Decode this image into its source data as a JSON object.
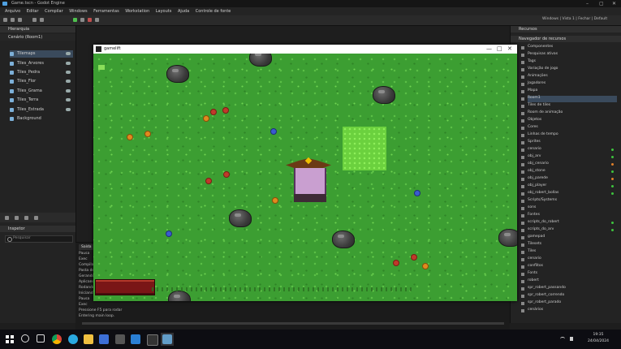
{
  "editor": {
    "title": "Game.tscn - Godot Engine",
    "menus": [
      "Arquivo",
      "Editar",
      "Compilar",
      "Windows",
      "Ferramentas",
      "Workstation",
      "Layouts",
      "Ajuda",
      "Controle de fonte"
    ],
    "right_info": "Windows | Vista 1 | Fechar | Default"
  },
  "hierarchy": {
    "header": "Hierarquia",
    "filter_label": "Cenário (Room1)",
    "items": [
      {
        "label": "Tilemaps"
      },
      {
        "label": "Tiles_Arvores"
      },
      {
        "label": "Tiles_Pedra"
      },
      {
        "label": "Tiles_Flor"
      },
      {
        "label": "Tiles_Grama"
      },
      {
        "label": "Tiles_Terra"
      },
      {
        "label": "Tiles_Estrada"
      },
      {
        "label": "Background"
      }
    ],
    "inspector_header": "Inspetor",
    "search_placeholder": "Pesquisar"
  },
  "right_panel": {
    "header": "Navegador de recursos",
    "search_label": "Recursos",
    "items": [
      {
        "label": "Componentes",
        "dot": ""
      },
      {
        "label": "Pesquisas ativas",
        "dot": ""
      },
      {
        "label": "Tags",
        "dot": ""
      },
      {
        "label": "Variação de jogo",
        "dot": ""
      },
      {
        "label": "Animações",
        "dot": ""
      },
      {
        "label": "Jogadores",
        "dot": ""
      },
      {
        "label": "Mapa",
        "dot": ""
      },
      {
        "label": "Room1",
        "dot": ""
      },
      {
        "label": "Tiles de tiles",
        "dot": ""
      },
      {
        "label": "Room de animação",
        "dot": ""
      },
      {
        "label": "Objetos",
        "dot": ""
      },
      {
        "label": "Cores",
        "dot": ""
      },
      {
        "label": "Linhas de tempo",
        "dot": ""
      },
      {
        "label": "Sprites",
        "dot": ""
      },
      {
        "label": "cenario",
        "dot": "#3ec43e"
      },
      {
        "label": "obj_arv",
        "dot": "#3ec43e"
      },
      {
        "label": "obj_cenario",
        "dot": "#e0802a"
      },
      {
        "label": "obj_stone",
        "dot": "#3ec43e"
      },
      {
        "label": "obj_parede",
        "dot": "#e0802a"
      },
      {
        "label": "obj_player",
        "dot": "#3ec43e"
      },
      {
        "label": "obj_robert_bollas",
        "dot": "#3ec43e"
      },
      {
        "label": "Scripts/Systems",
        "dot": ""
      },
      {
        "label": "sons",
        "dot": ""
      },
      {
        "label": "Fontes",
        "dot": ""
      },
      {
        "label": "scripts_do_robert",
        "dot": "#3ec43e"
      },
      {
        "label": "scripts_do_arv",
        "dot": "#3ec43e"
      },
      {
        "label": "gamepad",
        "dot": ""
      },
      {
        "label": "Tilesets",
        "dot": ""
      },
      {
        "label": "Tiles",
        "dot": ""
      },
      {
        "label": "cenario",
        "dot": ""
      },
      {
        "label": "conflitos",
        "dot": ""
      },
      {
        "label": "Fonts",
        "dot": ""
      },
      {
        "label": "robert",
        "dot": ""
      },
      {
        "label": "spr_robert_passando",
        "dot": ""
      },
      {
        "label": "spr_robert_correndo",
        "dot": ""
      },
      {
        "label": "spr_robert_parado",
        "dot": ""
      },
      {
        "label": "cenários",
        "dot": ""
      }
    ]
  },
  "output": {
    "tab": "Saída",
    "lines": [
      "Pausa",
      "Exec",
      "Compilando...",
      "Pasta de projeto",
      "Gerando pacotes",
      "Aplicando",
      "Rodando",
      "Iniciando cenário",
      "Pausa",
      "Exec",
      "Pressione F5 para rodar",
      "Entering main loop."
    ]
  },
  "game": {
    "window_title": "gamelift",
    "controls": [
      "—",
      "□",
      "✕"
    ]
  },
  "taskbar": {
    "time": "19:35",
    "date": "24/04/2024"
  }
}
